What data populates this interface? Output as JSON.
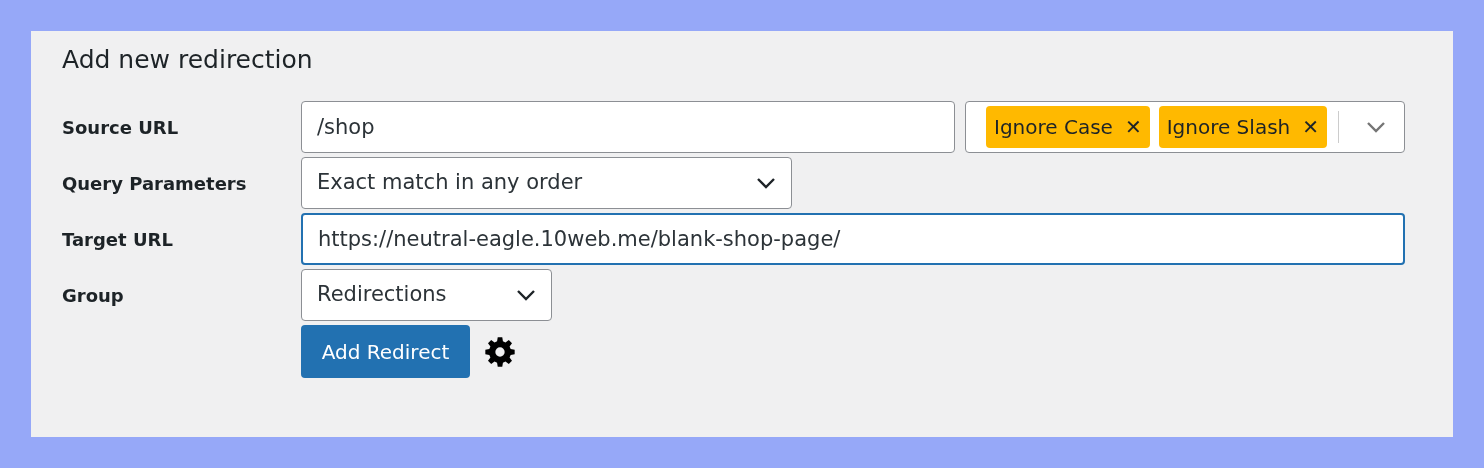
{
  "title": "Add new redirection",
  "rows": [
    {
      "label": "Source URL",
      "kind": "text",
      "value": "/shop",
      "focused": false,
      "tags": [
        {
          "label": "Ignore Case",
          "remove": "✕"
        },
        {
          "label": "Ignore Slash",
          "remove": "✕"
        }
      ]
    },
    {
      "label": "Query Parameters",
      "kind": "select",
      "value": "Exact match in any order",
      "focused": false
    },
    {
      "label": "Target URL",
      "kind": "text",
      "value": "https://neutral-eagle.10web.me/blank-shop-page/",
      "focused": true
    },
    {
      "label": "Group",
      "kind": "select",
      "value": "Redirections",
      "focused": false
    }
  ],
  "submit": "Add Redirect"
}
